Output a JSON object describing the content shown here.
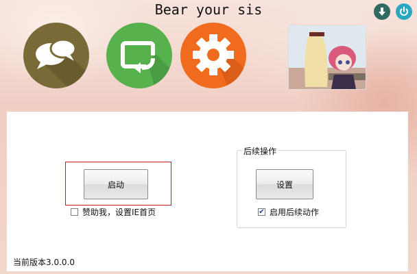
{
  "window": {
    "title": "Bear your sis"
  },
  "header_buttons": [
    {
      "icon": "download-icon",
      "color": "#2f6b63"
    },
    {
      "icon": "power-icon",
      "color": "#2aa8c2"
    }
  ],
  "feature_icons": [
    {
      "icon": "chat-bubbles-icon",
      "color": "#7a6a38"
    },
    {
      "icon": "refresh-window-icon",
      "color": "#57b24e"
    },
    {
      "icon": "gear-icon",
      "color": "#f16b1f"
    }
  ],
  "main": {
    "start_button": "启动",
    "support_checkbox": {
      "label": "赞助我，设置IE首页",
      "checked": false
    },
    "followup_group": {
      "label": "后续操作",
      "settings_button": "设置",
      "enable_checkbox": {
        "label": "启用后续动作",
        "checked": true
      }
    }
  },
  "footer": {
    "version": "当前版本3.0.0.0"
  },
  "colors": {
    "highlight_border": "#c7161c"
  }
}
